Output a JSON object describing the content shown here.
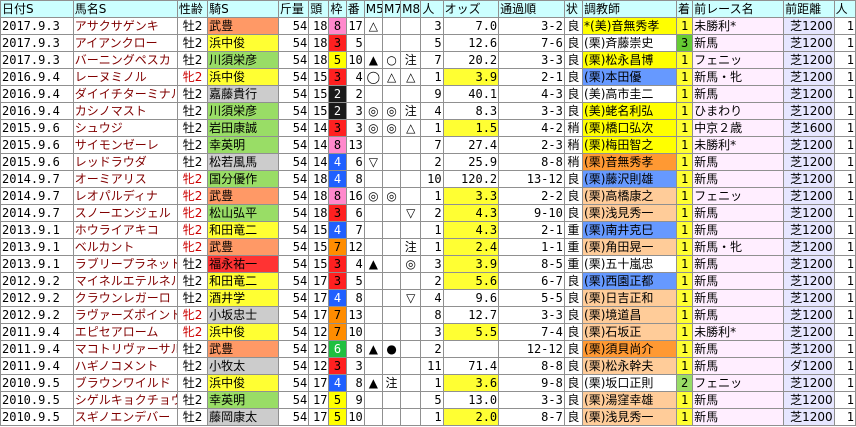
{
  "headers": [
    "日付S",
    "馬名S",
    "性齢",
    "騎S",
    "斤量",
    "頭",
    "枠",
    "番",
    "M5",
    "M7",
    "M8",
    "人",
    "オッズ",
    "通過順",
    "状",
    "調教師",
    "着",
    "前レース名",
    "前距離",
    "人"
  ],
  "colors": {
    "header_bg": "#ccffff",
    "frame": {
      "1": "#ffffff",
      "2": "#1a1a1a",
      "3": "#ff2020",
      "4": "#2060ff",
      "5": "#ffff00",
      "6": "#20c040",
      "7": "#ff8c00",
      "8": "#ff88cc"
    },
    "jockey_bg": {
      "orange": "#ff9966",
      "yellow": "#ffff33",
      "green": "#99dd66",
      "gray": "#cccccc",
      "red": "#ff3333",
      "white": "#ffffff"
    },
    "odds_bg": {
      "y": "#ffff33",
      "w": "#ffffff"
    },
    "trainer_bg": {
      "k": "#ffff00",
      "m": "#ffcc99",
      "b": "#6699ff",
      "e": "#ff9933",
      "w": "#ffffff"
    },
    "finish_bg": {
      "1": "#ffff33",
      "2": "#99dd66",
      "3": "#66cc33",
      "4": "#ffffff"
    },
    "prev_bg": "#ffeeff",
    "dist_bg": "#e6e6ff"
  },
  "rows": [
    {
      "date": "2017.9.3",
      "horse": "アサクサゲンキ",
      "sex": "牡2",
      "jockey": "武豊",
      "jbg": "orange",
      "wt": "54",
      "n": "18",
      "frame": "8",
      "umaban": "17",
      "m5": "△",
      "m7": "",
      "m8": "",
      "pop": "3",
      "odds": "7.0",
      "obg": "w",
      "pass": "3-2",
      "cond": "良",
      "trainer": "*(美)音無秀孝",
      "tbg": "k",
      "fin": "1",
      "prev": "未勝利*",
      "pbg": "prev",
      "dist": "芝1200",
      "last": "1"
    },
    {
      "date": "2017.9.3",
      "horse": "アイアンクロー",
      "sex": "牡2",
      "jockey": "浜中俊",
      "jbg": "yellow",
      "wt": "54",
      "n": "18",
      "frame": "3",
      "umaban": "5",
      "m5": "",
      "m7": "",
      "m8": "",
      "pop": "5",
      "odds": "12.6",
      "obg": "w",
      "pass": "7-6",
      "cond": "良",
      "trainer": "(栗)斉藤崇史",
      "tbg": "w",
      "fin": "3",
      "prev": "新馬",
      "pbg": "prev",
      "dist": "芝1200",
      "last": "1"
    },
    {
      "date": "2017.9.3",
      "horse": "バーニングペスカ",
      "sex": "牡2",
      "jockey": "川須栄彦",
      "jbg": "green",
      "wt": "54",
      "n": "18",
      "frame": "5",
      "umaban": "10",
      "m5": "▲",
      "m7": "○",
      "m8": "注",
      "pop": "7",
      "odds": "20.2",
      "obg": "w",
      "pass": "3-3",
      "cond": "良",
      "trainer": "(栗)松永昌博",
      "tbg": "k",
      "fin": "1",
      "prev": "フェニッ",
      "pbg": "prev",
      "dist": "芝1200",
      "last": "1"
    },
    {
      "date": "2016.9.4",
      "horse": "レーヌミノル",
      "sex": "牝2",
      "jockey": "浜中俊",
      "jbg": "yellow",
      "wt": "54",
      "n": "15",
      "frame": "3",
      "umaban": "4",
      "m5": "◯",
      "m7": "△",
      "m8": "△",
      "pop": "1",
      "odds": "3.9",
      "obg": "y",
      "pass": "2-1",
      "cond": "良",
      "trainer": "(栗)本田優",
      "tbg": "b",
      "fin": "1",
      "prev": "新馬・牝",
      "pbg": "prev",
      "dist": "芝1200",
      "last": "1"
    },
    {
      "date": "2016.9.4",
      "horse": "ダイイチターミナル",
      "sex": "牡2",
      "jockey": "嘉藤貴行",
      "jbg": "gray",
      "wt": "54",
      "n": "15",
      "frame": "2",
      "umaban": "2",
      "m5": "",
      "m7": "",
      "m8": "",
      "pop": "9",
      "odds": "40.1",
      "obg": "w",
      "pass": "4-3",
      "cond": "良",
      "trainer": "(美)高市圭二",
      "tbg": "w",
      "fin": "1",
      "prev": "新馬",
      "pbg": "prev",
      "dist": "芝1200",
      "last": "1"
    },
    {
      "date": "2016.9.4",
      "horse": "カシノマスト",
      "sex": "牡2",
      "jockey": "川須栄彦",
      "jbg": "green",
      "wt": "54",
      "n": "15",
      "frame": "2",
      "umaban": "3",
      "m5": "◎",
      "m7": "◎",
      "m8": "注",
      "pop": "4",
      "odds": "8.3",
      "obg": "w",
      "pass": "3-3",
      "cond": "良",
      "trainer": "(美)蛯名利弘",
      "tbg": "k",
      "fin": "1",
      "prev": "ひまわり",
      "pbg": "prev",
      "dist": "芝1200",
      "last": "1"
    },
    {
      "date": "2015.9.6",
      "horse": "シュウジ",
      "sex": "牡2",
      "jockey": "岩田康誠",
      "jbg": "green",
      "wt": "54",
      "n": "14",
      "frame": "3",
      "umaban": "3",
      "m5": "◎",
      "m7": "◎",
      "m8": "△",
      "pop": "1",
      "odds": "1.5",
      "obg": "y",
      "pass": "4-2",
      "cond": "稍",
      "trainer": "(栗)橋口弘次",
      "tbg": "k",
      "fin": "1",
      "prev": "中京２歳",
      "pbg": "prev",
      "dist": "芝1600",
      "last": "1"
    },
    {
      "date": "2015.9.6",
      "horse": "サイモンゼーレ",
      "sex": "牡2",
      "jockey": "幸英明",
      "jbg": "green",
      "wt": "54",
      "n": "14",
      "frame": "8",
      "umaban": "13",
      "m5": "",
      "m7": "",
      "m8": "",
      "pop": "7",
      "odds": "27.4",
      "obg": "w",
      "pass": "2-3",
      "cond": "稍",
      "trainer": "(栗)梅田智之",
      "tbg": "k",
      "fin": "1",
      "prev": "未勝利*",
      "pbg": "prev",
      "dist": "芝1200",
      "last": "1"
    },
    {
      "date": "2015.9.6",
      "horse": "レッドラウダ",
      "sex": "牡2",
      "jockey": "松若風馬",
      "jbg": "gray",
      "wt": "54",
      "n": "14",
      "frame": "4",
      "umaban": "6",
      "m5": "▽",
      "m7": "",
      "m8": "",
      "pop": "2",
      "odds": "25.9",
      "obg": "w",
      "pass": "8-8",
      "cond": "稍",
      "trainer": "(栗)音無秀孝",
      "tbg": "e",
      "fin": "1",
      "prev": "新馬",
      "pbg": "prev",
      "dist": "芝1200",
      "last": "1"
    },
    {
      "date": "2014.9.7",
      "horse": "オーミアリス",
      "sex": "牝2",
      "jockey": "国分優作",
      "jbg": "green",
      "wt": "54",
      "n": "18",
      "frame": "4",
      "umaban": "8",
      "m5": "",
      "m7": "",
      "m8": "",
      "pop": "10",
      "odds": "120.2",
      "obg": "w",
      "pass": "13-12",
      "cond": "良",
      "trainer": "(栗)藤沢則雄",
      "tbg": "b",
      "fin": "1",
      "prev": "新馬",
      "pbg": "prev",
      "dist": "芝1200",
      "last": "1"
    },
    {
      "date": "2014.9.7",
      "horse": "レオパルディナ",
      "sex": "牝2",
      "jockey": "武豊",
      "jbg": "orange",
      "wt": "54",
      "n": "18",
      "frame": "8",
      "umaban": "16",
      "m5": "◎",
      "m7": "◎",
      "m8": "",
      "pop": "1",
      "odds": "3.3",
      "obg": "y",
      "pass": "2-2",
      "cond": "良",
      "trainer": "(栗)高橋康之",
      "tbg": "m",
      "fin": "1",
      "prev": "フェニッ",
      "pbg": "prev",
      "dist": "芝1200",
      "last": "1"
    },
    {
      "date": "2014.9.7",
      "horse": "スノーエンジェル",
      "sex": "牝2",
      "jockey": "松山弘平",
      "jbg": "green",
      "wt": "54",
      "n": "18",
      "frame": "3",
      "umaban": "6",
      "m5": "",
      "m7": "",
      "m8": "▽",
      "pop": "2",
      "odds": "4.3",
      "obg": "y",
      "pass": "9-10",
      "cond": "良",
      "trainer": "(栗)浅見秀一",
      "tbg": "m",
      "fin": "1",
      "prev": "新馬",
      "pbg": "prev",
      "dist": "芝1200",
      "last": "1"
    },
    {
      "date": "2013.9.1",
      "horse": "ホウライアキコ",
      "sex": "牝2",
      "jockey": "和田竜二",
      "jbg": "yellow",
      "wt": "54",
      "n": "15",
      "frame": "4",
      "umaban": "7",
      "m5": "",
      "m7": "",
      "m8": "",
      "pop": "1",
      "odds": "4.3",
      "obg": "y",
      "pass": "2-1",
      "cond": "重",
      "trainer": "(栗)南井克巳",
      "tbg": "b",
      "fin": "1",
      "prev": "新馬",
      "pbg": "prev",
      "dist": "芝1200",
      "last": "1"
    },
    {
      "date": "2013.9.1",
      "horse": "ベルカント",
      "sex": "牝2",
      "jockey": "武豊",
      "jbg": "orange",
      "wt": "54",
      "n": "15",
      "frame": "7",
      "umaban": "12",
      "m5": "",
      "m7": "",
      "m8": "注",
      "pop": "1",
      "odds": "2.4",
      "obg": "y",
      "pass": "1-1",
      "cond": "重",
      "trainer": "(栗)角田晃一",
      "tbg": "m",
      "fin": "1",
      "prev": "新馬・牝",
      "pbg": "prev",
      "dist": "芝1200",
      "last": "1"
    },
    {
      "date": "2013.9.1",
      "horse": "ラブリープラネット",
      "sex": "牡2",
      "jockey": "福永祐一",
      "jbg": "red",
      "wt": "54",
      "n": "15",
      "frame": "3",
      "umaban": "4",
      "m5": "▲",
      "m7": "",
      "m8": "◎",
      "pop": "3",
      "odds": "3.9",
      "obg": "y",
      "pass": "8-5",
      "cond": "重",
      "trainer": "(栗)五十嵐忠",
      "tbg": "w",
      "fin": "1",
      "prev": "新馬",
      "pbg": "prev",
      "dist": "芝1200",
      "last": "1"
    },
    {
      "date": "2012.9.2",
      "horse": "マイネルエテルネル",
      "sex": "牡2",
      "jockey": "和田竜二",
      "jbg": "yellow",
      "wt": "54",
      "n": "17",
      "frame": "3",
      "umaban": "5",
      "m5": "",
      "m7": "",
      "m8": "",
      "pop": "2",
      "odds": "5.6",
      "obg": "y",
      "pass": "6-7",
      "cond": "良",
      "trainer": "(栗)西園正都",
      "tbg": "b",
      "fin": "1",
      "prev": "新馬",
      "pbg": "prev",
      "dist": "芝1200",
      "last": "1"
    },
    {
      "date": "2012.9.2",
      "horse": "クラウンレガーロ",
      "sex": "牡2",
      "jockey": "酒井学",
      "jbg": "yellow",
      "wt": "54",
      "n": "17",
      "frame": "4",
      "umaban": "8",
      "m5": "",
      "m7": "",
      "m8": "▽",
      "pop": "4",
      "odds": "9.6",
      "obg": "w",
      "pass": "5-5",
      "cond": "良",
      "trainer": "(栗)日吉正和",
      "tbg": "m",
      "fin": "1",
      "prev": "新馬",
      "pbg": "prev",
      "dist": "芝1200",
      "last": "1"
    },
    {
      "date": "2012.9.2",
      "horse": "ラヴァーズポイント",
      "sex": "牝2",
      "jockey": "小坂忠士",
      "jbg": "gray",
      "wt": "54",
      "n": "17",
      "frame": "7",
      "umaban": "13",
      "m5": "",
      "m7": "",
      "m8": "",
      "pop": "8",
      "odds": "12.7",
      "obg": "w",
      "pass": "3-3",
      "cond": "良",
      "trainer": "(栗)境道昌",
      "tbg": "m",
      "fin": "1",
      "prev": "新馬",
      "pbg": "prev",
      "dist": "芝1200",
      "last": "1"
    },
    {
      "date": "2011.9.4",
      "horse": "エピセアローム",
      "sex": "牝2",
      "jockey": "浜中俊",
      "jbg": "yellow",
      "wt": "54",
      "n": "12",
      "frame": "7",
      "umaban": "10",
      "m5": "",
      "m7": "",
      "m8": "",
      "pop": "3",
      "odds": "5.5",
      "obg": "y",
      "pass": "7-4",
      "cond": "良",
      "trainer": "(栗)石坂正",
      "tbg": "m",
      "fin": "1",
      "prev": "未勝利*",
      "pbg": "prev",
      "dist": "芝1200",
      "last": "1"
    },
    {
      "date": "2011.9.4",
      "horse": "マコトリヴァーサル",
      "sex": "牡2",
      "jockey": "武豊",
      "jbg": "orange",
      "wt": "54",
      "n": "12",
      "frame": "6",
      "umaban": "8",
      "m5": "▲",
      "m7": "●",
      "m8": "",
      "pop": "2",
      "odds": "",
      "obg": "w",
      "pass": "12-12",
      "cond": "良",
      "trainer": "(栗)須貝尚介",
      "tbg": "e",
      "fin": "1",
      "prev": "新馬",
      "pbg": "prev",
      "dist": "芝1200",
      "last": "1"
    },
    {
      "date": "2011.9.4",
      "horse": "ハギノコメント",
      "sex": "牡2",
      "jockey": "小牧太",
      "jbg": "gray",
      "wt": "54",
      "n": "12",
      "frame": "3",
      "umaban": "3",
      "m5": "",
      "m7": "",
      "m8": "",
      "pop": "11",
      "odds": "71.4",
      "obg": "w",
      "pass": "8-8",
      "cond": "良",
      "trainer": "(栗)松永幹夫",
      "tbg": "m",
      "fin": "1",
      "prev": "新馬",
      "pbg": "prev",
      "dist": "ダ1200",
      "last": "1"
    },
    {
      "date": "2010.9.5",
      "horse": "ブラウンワイルド",
      "sex": "牡2",
      "jockey": "浜中俊",
      "jbg": "yellow",
      "wt": "54",
      "n": "17",
      "frame": "4",
      "umaban": "8",
      "m5": "▲",
      "m7": "注",
      "m8": "",
      "pop": "1",
      "odds": "3.6",
      "obg": "y",
      "pass": "9-8",
      "cond": "良",
      "trainer": "(栗)坂口正則",
      "tbg": "w",
      "fin": "2",
      "prev": "フェニッ",
      "pbg": "prev",
      "dist": "芝1200",
      "last": "1"
    },
    {
      "date": "2010.9.5",
      "horse": "シゲルキョクチョウ",
      "sex": "牡2",
      "jockey": "幸英明",
      "jbg": "green",
      "wt": "54",
      "n": "17",
      "frame": "5",
      "umaban": "9",
      "m5": "",
      "m7": "",
      "m8": "",
      "pop": "5",
      "odds": "13.0",
      "obg": "w",
      "pass": "3-3",
      "cond": "良",
      "trainer": "(栗)湯窪幸雄",
      "tbg": "m",
      "fin": "1",
      "prev": "新馬",
      "pbg": "prev",
      "dist": "芝1200",
      "last": "1"
    },
    {
      "date": "2010.9.5",
      "horse": "スギノエンデバー",
      "sex": "牡2",
      "jockey": "藤岡康太",
      "jbg": "gray",
      "wt": "54",
      "n": "17",
      "frame": "5",
      "umaban": "10",
      "m5": "",
      "m7": "",
      "m8": "",
      "pop": "1",
      "odds": "2.0",
      "obg": "y",
      "pass": "8-7",
      "cond": "良",
      "trainer": "(栗)浅見秀一",
      "tbg": "m",
      "fin": "1",
      "prev": "新馬",
      "pbg": "prev",
      "dist": "芝1200",
      "last": "1"
    }
  ]
}
